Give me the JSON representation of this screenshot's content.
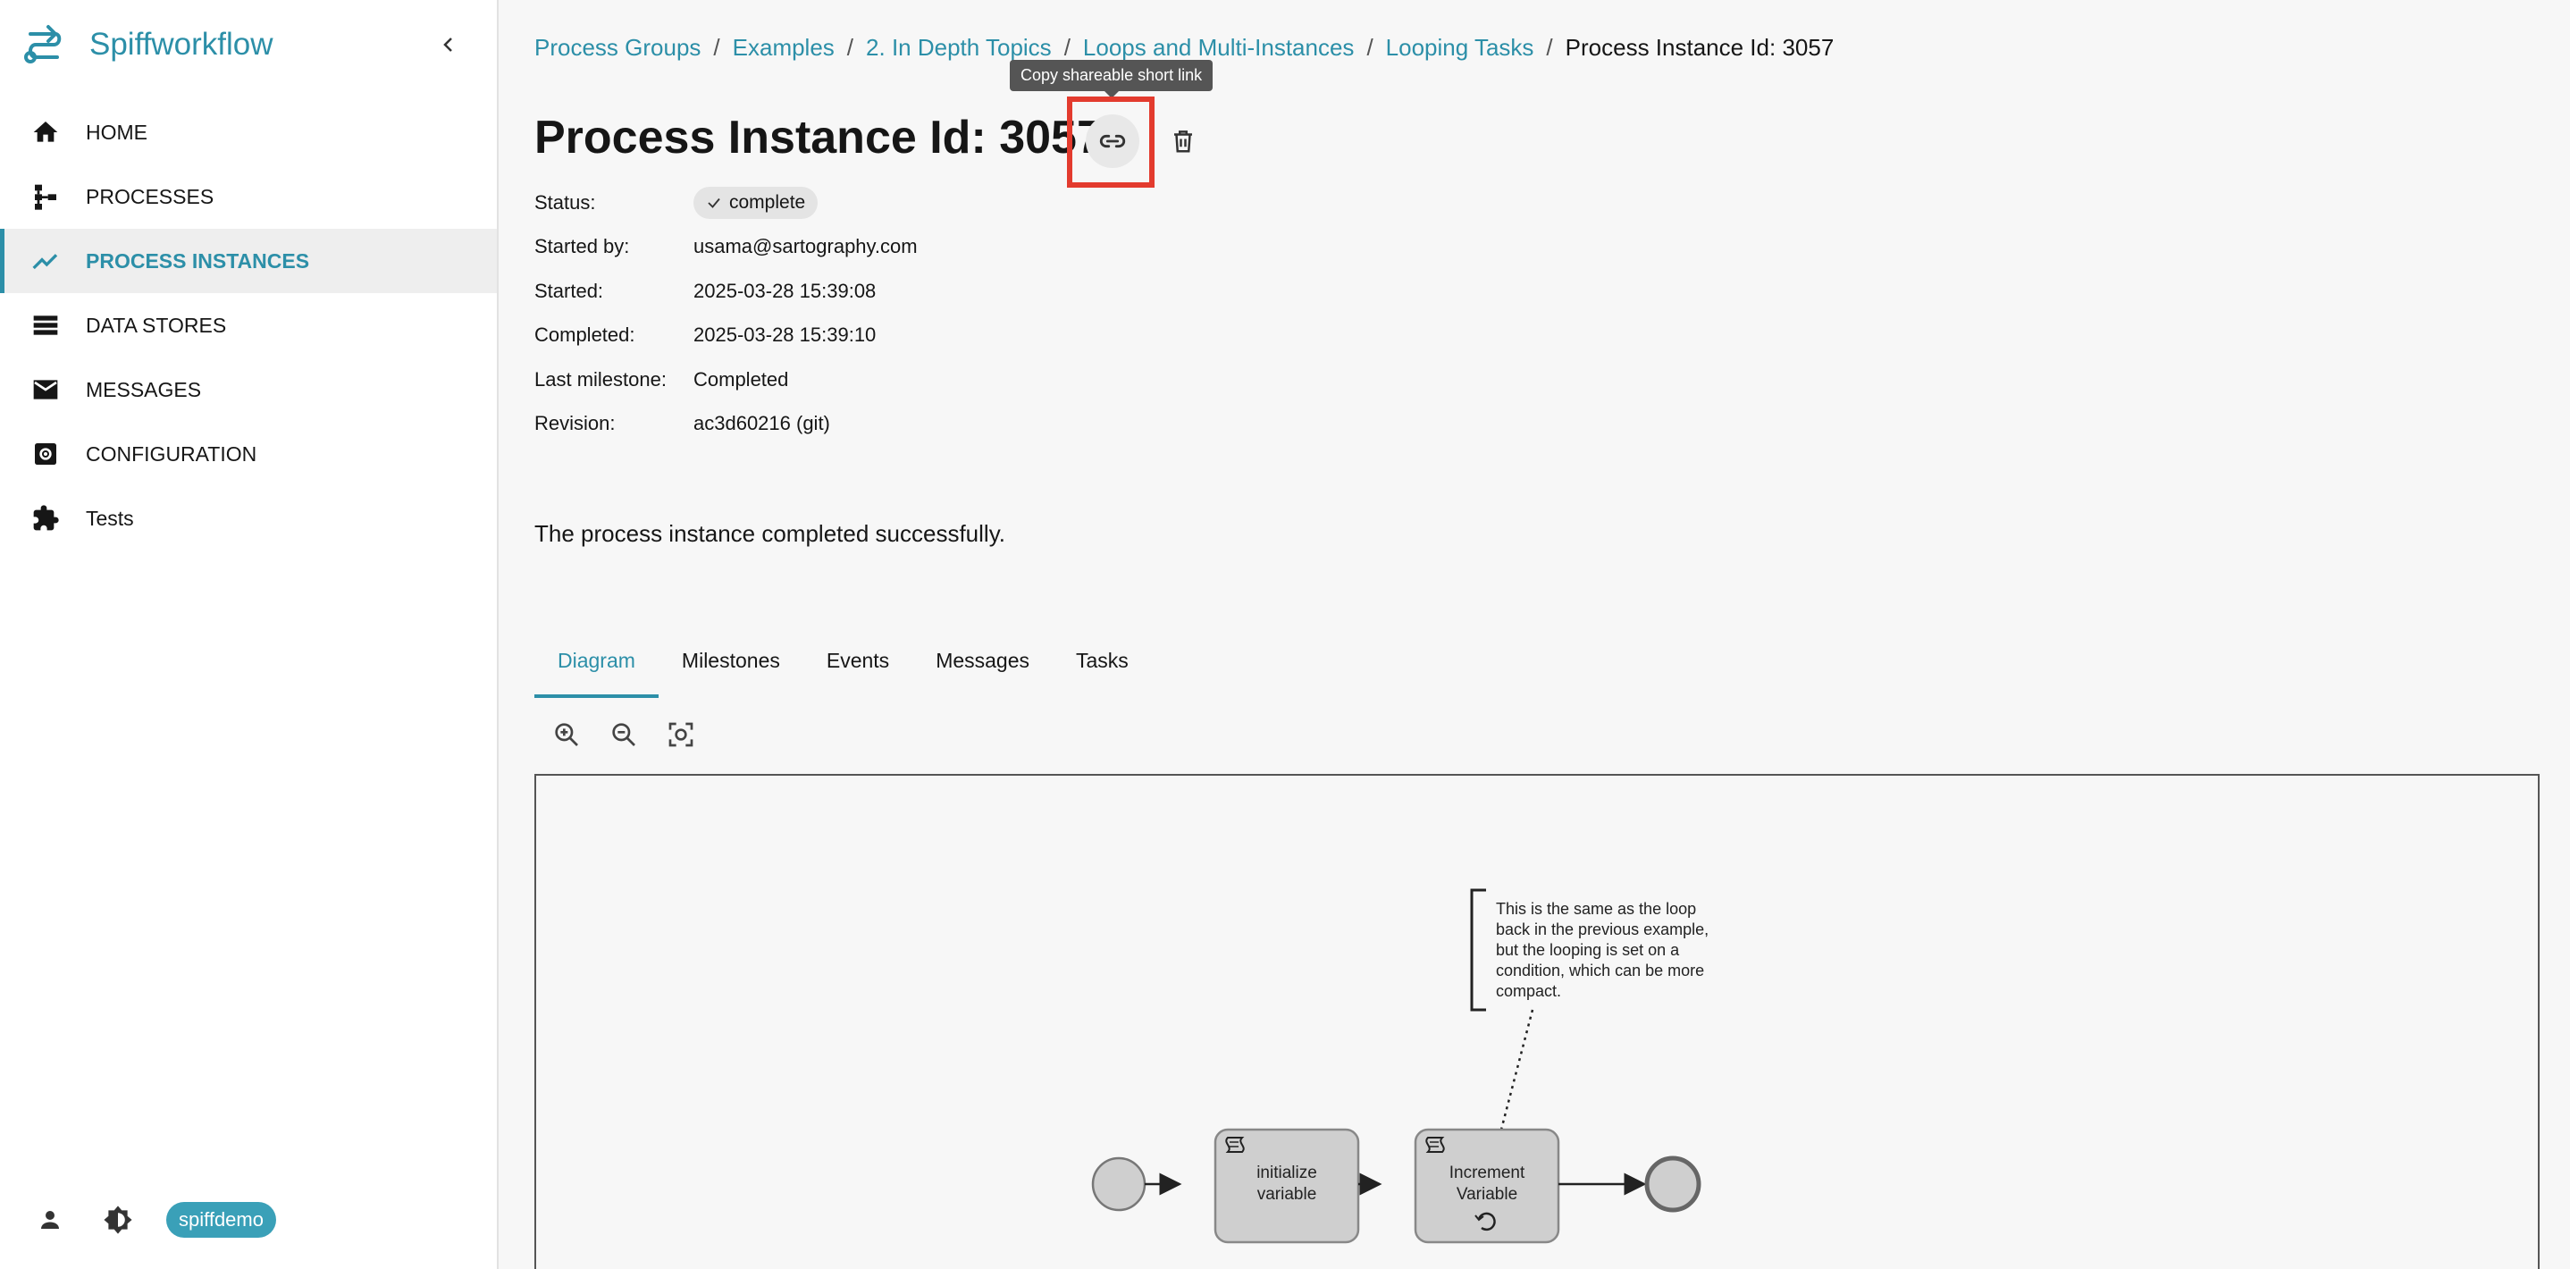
{
  "app": {
    "name": "Spiffworkflow"
  },
  "sidebar": {
    "items": [
      {
        "label": "HOME",
        "icon": "home-icon",
        "active": false
      },
      {
        "label": "PROCESSES",
        "icon": "process-tree-icon",
        "active": false
      },
      {
        "label": "PROCESS INSTANCES",
        "icon": "trending-up-icon",
        "active": true
      },
      {
        "label": "DATA STORES",
        "icon": "storage-icon",
        "active": false
      },
      {
        "label": "MESSAGES",
        "icon": "mail-icon",
        "active": false
      },
      {
        "label": "CONFIGURATION",
        "icon": "settings-icon",
        "active": false
      },
      {
        "label": "Tests",
        "icon": "puzzle-icon",
        "active": false
      }
    ],
    "footer": {
      "user": "spiffdemo"
    }
  },
  "breadcrumb": {
    "items": [
      "Process Groups",
      "Examples",
      "2. In Depth Topics",
      "Loops and Multi-Instances",
      "Looping Tasks"
    ],
    "current": "Process Instance Id: 3057"
  },
  "tooltip": "Copy shareable short link",
  "title": "Process Instance Id: 3057",
  "meta": {
    "status_label": "Status:",
    "status": "complete",
    "started_by_label": "Started by:",
    "started_by": "usama@sartography.com",
    "started_label": "Started:",
    "started": "2025-03-28 15:39:08",
    "completed_label": "Completed:",
    "completed": "2025-03-28 15:39:10",
    "milestone_label": "Last milestone:",
    "milestone": "Completed",
    "revision_label": "Revision:",
    "revision": "ac3d60216 (git)"
  },
  "message": "The process instance completed successfully.",
  "tabs": [
    "Diagram",
    "Milestones",
    "Events",
    "Messages",
    "Tasks"
  ],
  "diagram": {
    "annotation": [
      "This is the same as the loop",
      "back in the previous example,",
      "but the looping is set on a",
      "condition, which can be more",
      "compact."
    ],
    "task1": [
      "initialize",
      "variable"
    ],
    "task2": [
      "Increment",
      "Variable"
    ]
  },
  "colors": {
    "accent": "#2c8fa8",
    "highlight": "#e33b2e"
  }
}
